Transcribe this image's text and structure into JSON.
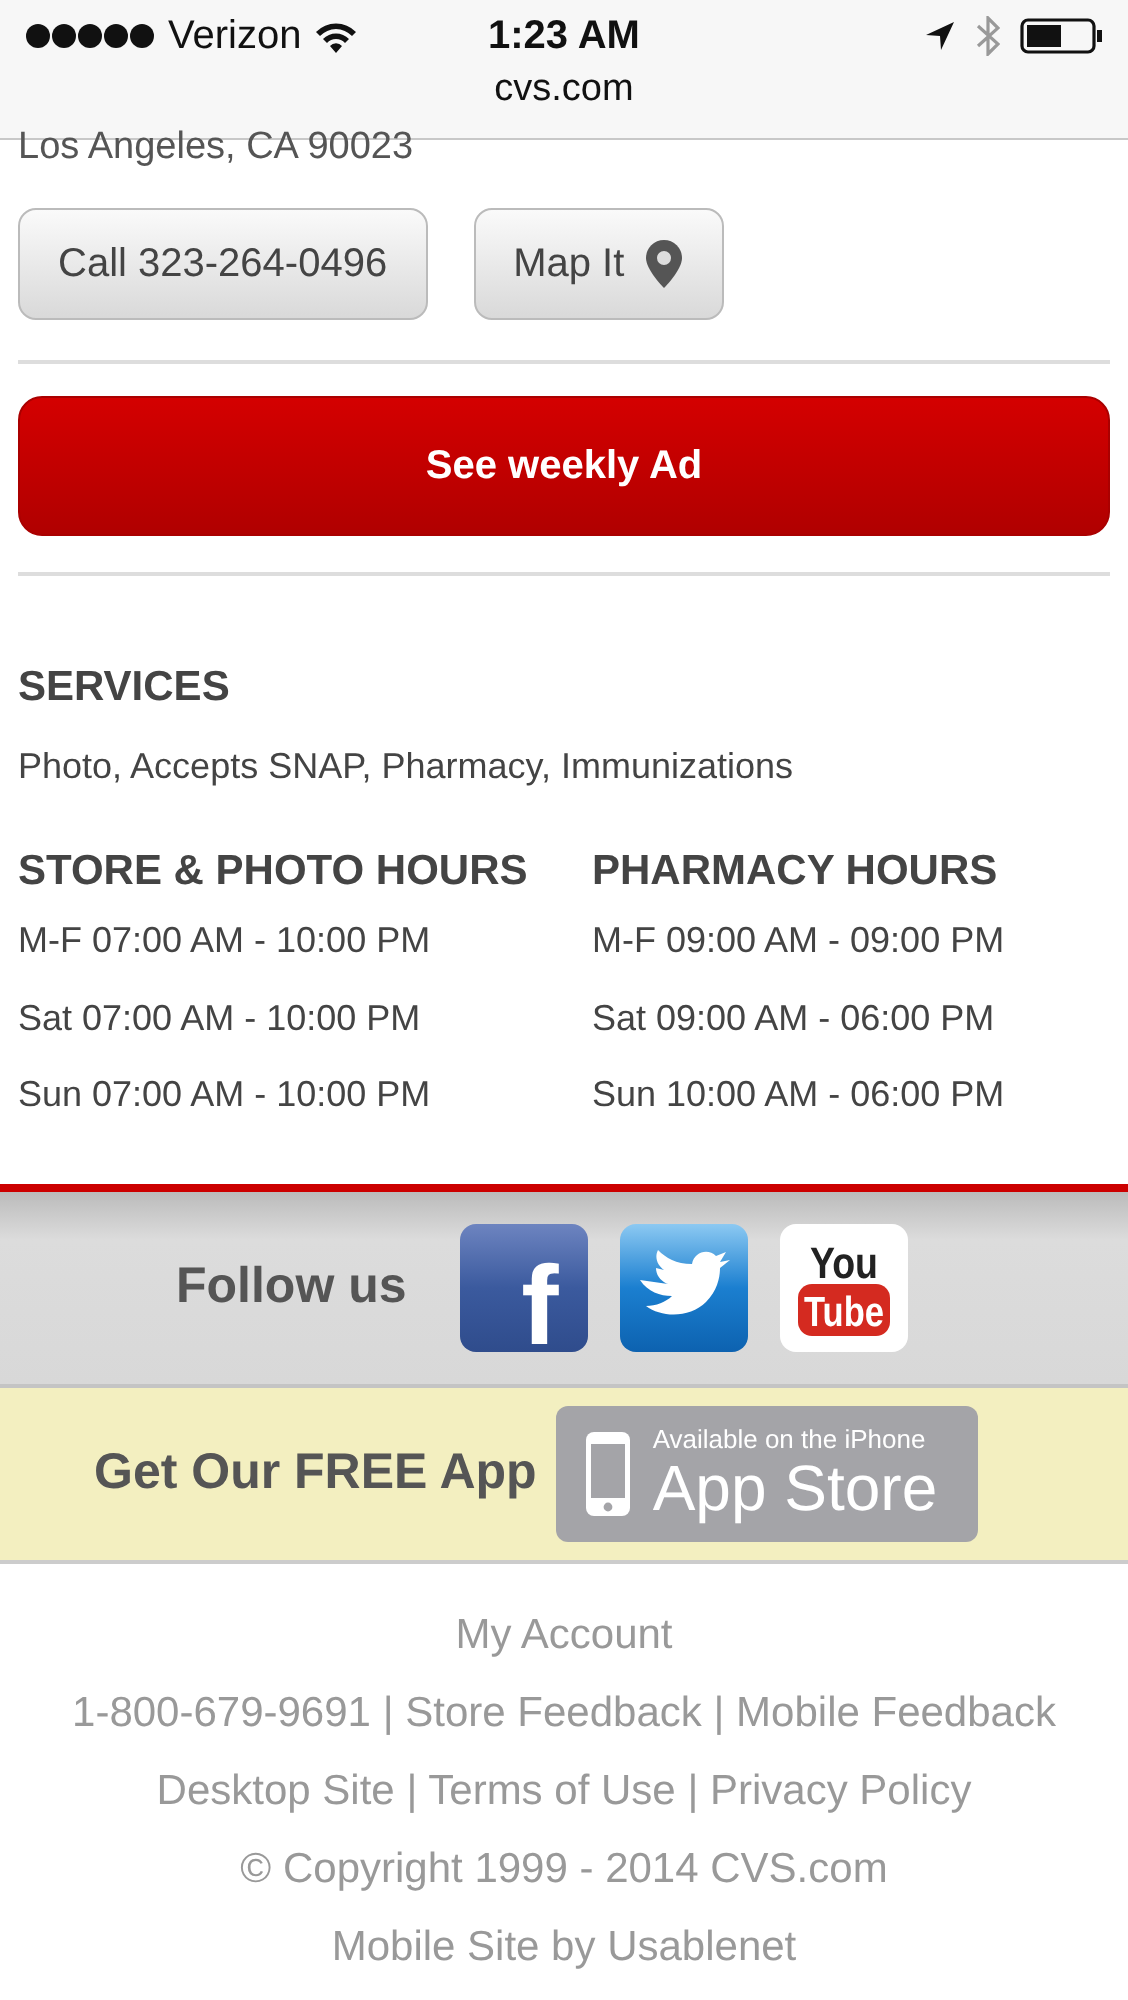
{
  "status_bar": {
    "carrier": "Verizon",
    "time": "1:23 AM",
    "url": "cvs.com"
  },
  "address": "Los Angeles, CA 90023",
  "actions": [
    {
      "label": "Call 323-264-0496",
      "kind": "call"
    },
    {
      "label": "Map It",
      "kind": "map"
    }
  ],
  "weekly_ad_button": "See weekly Ad",
  "services": {
    "title": "SERVICES",
    "text": "Photo, Accepts SNAP, Pharmacy, Immunizations"
  },
  "hours": [
    {
      "title": "STORE & PHOTO HOURS",
      "rows": [
        "M-F 07:00 AM - 10:00 PM",
        "Sat 07:00 AM - 10:00 PM",
        "Sun 07:00 AM - 10:00 PM"
      ]
    },
    {
      "title": "PHARMACY HOURS",
      "rows": [
        "M-F 09:00 AM - 09:00 PM",
        "Sat 09:00 AM - 06:00 PM",
        "Sun 10:00 AM - 06:00 PM"
      ]
    }
  ],
  "follow": {
    "label": "Follow us",
    "social": [
      {
        "kind": "facebook",
        "glyph": "f"
      },
      {
        "kind": "twitter"
      },
      {
        "kind": "youtube",
        "top": "You",
        "bottom": "Tube"
      }
    ]
  },
  "app": {
    "label": "Get Our FREE App",
    "badge_small": "Available on the iPhone",
    "badge_large": "App Store"
  },
  "footer": {
    "separator": "|",
    "rows": [
      {
        "kind": "links",
        "items": [
          "My Account"
        ]
      },
      {
        "kind": "links",
        "items": [
          "1-800-679-9691",
          "Store Feedback",
          "Mobile Feedback"
        ]
      },
      {
        "kind": "links",
        "items": [
          "Desktop Site",
          "Terms of Use",
          "Privacy Policy"
        ]
      },
      {
        "kind": "text",
        "text": "© Copyright 1999 - 2014 CVS.com"
      },
      {
        "kind": "text",
        "text": "Mobile Site by Usablenet"
      }
    ]
  }
}
